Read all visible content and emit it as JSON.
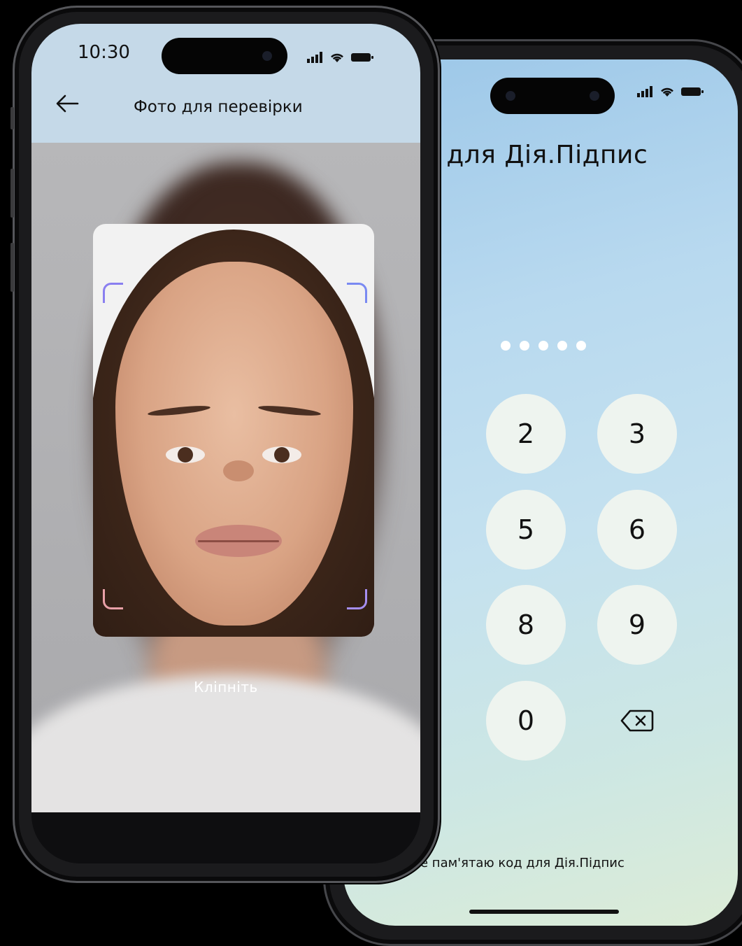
{
  "front_phone": {
    "status_bar": {
      "time": "10:30"
    },
    "nav": {
      "title": "Фото для перевірки",
      "back_icon": "arrow-left-icon"
    },
    "camera": {
      "instruction": "Кліпніть"
    }
  },
  "back_phone": {
    "title": "д для Дія.Підпис",
    "pin_length": 5,
    "keypad": [
      "2",
      "3",
      "5",
      "6",
      "8",
      "9",
      "0"
    ],
    "delete_icon": "backspace-icon",
    "forgot_link": "е пам'ятаю код для Дія.Підпис"
  },
  "colors": {
    "front_header": "#c5d9e8",
    "key_fill": "#eef4ef",
    "frame_corner_top": "#8a7ff0",
    "frame_corner_bottom": "#e8a0a8"
  }
}
